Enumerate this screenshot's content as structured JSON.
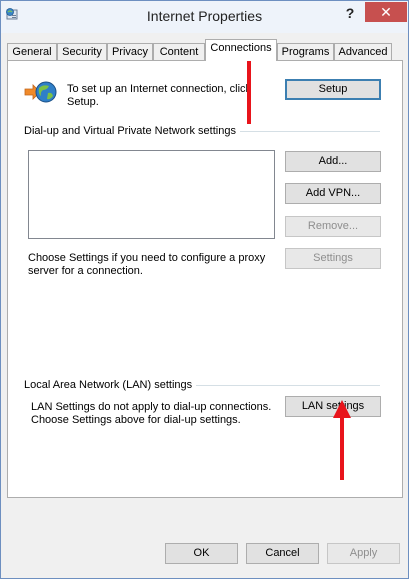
{
  "window": {
    "title": "Internet Properties",
    "help_label": "?",
    "close_label": "✕"
  },
  "tabs": [
    {
      "label": "General"
    },
    {
      "label": "Security"
    },
    {
      "label": "Privacy"
    },
    {
      "label": "Content"
    },
    {
      "label": "Connections",
      "active": true
    },
    {
      "label": "Programs"
    },
    {
      "label": "Advanced"
    }
  ],
  "connections": {
    "setup_text": "To set up an Internet connection, click Setup.",
    "setup_text_line1": "To set up an Internet connection, click",
    "setup_text_line2": "Setup.",
    "setup_button": "Setup",
    "dialup_group_label": "Dial-up and Virtual Private Network settings",
    "add_button": "Add...",
    "add_vpn_button": "Add VPN...",
    "remove_button": "Remove...",
    "settings_button": "Settings",
    "proxy_text_line1": "Choose Settings if you need to configure a proxy",
    "proxy_text_line2": "server for a connection.",
    "lan_group_label": "Local Area Network (LAN) settings",
    "lan_text_line1": "LAN Settings do not apply to dial-up connections.",
    "lan_text_line2": "Choose Settings above for dial-up settings.",
    "lan_settings_button": "LAN settings"
  },
  "footer": {
    "ok_label": "OK",
    "cancel_label": "Cancel",
    "apply_label": "Apply"
  },
  "annotations": {
    "arrow_color": "#e8141b"
  },
  "colors": {
    "close_button": "#c7504f",
    "default_button_border": "#3c7fb1"
  }
}
